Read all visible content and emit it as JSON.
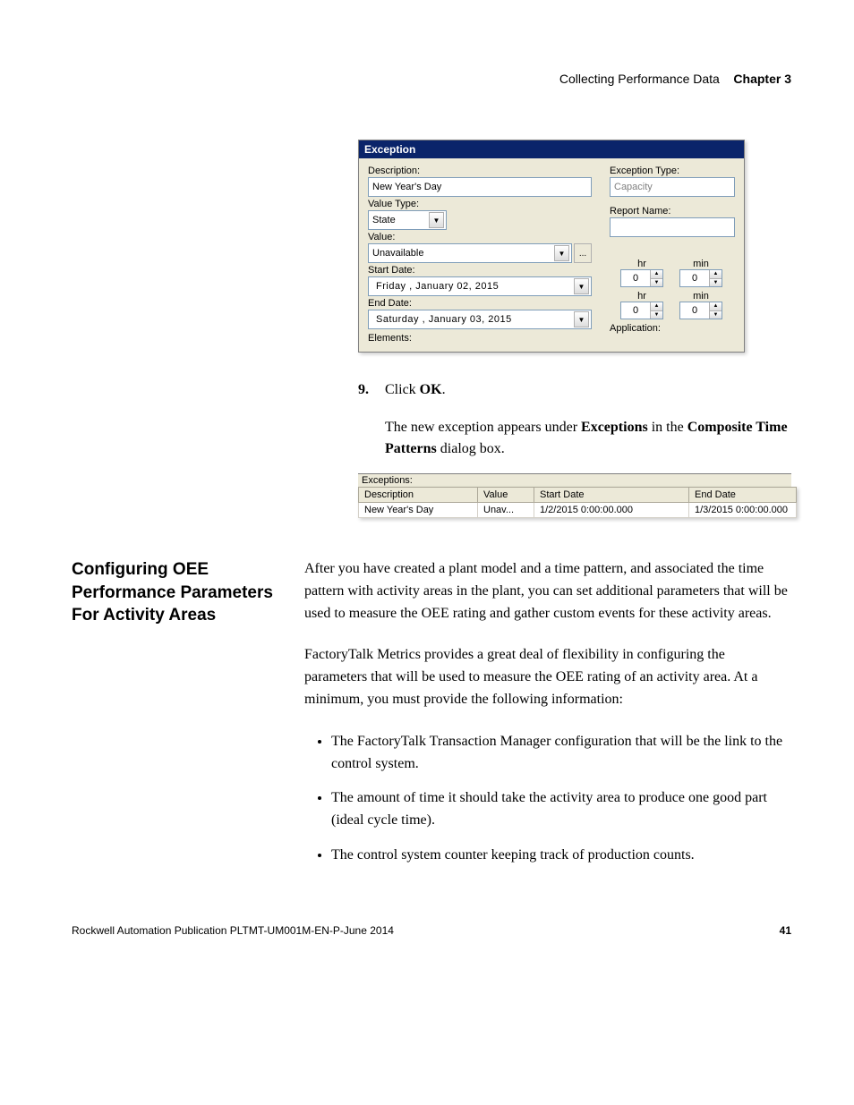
{
  "header": {
    "light": "Collecting Performance Data",
    "bold": "Chapter 3"
  },
  "dialog": {
    "title": "Exception",
    "description_label": "Description:",
    "description_value": "New Year's Day",
    "value_type_label": "Value Type:",
    "value_type_value": "State",
    "value_label": "Value:",
    "value_value": "Unavailable",
    "start_date_label": "Start Date:",
    "start_date_value": "Friday    ,   January   02, 2015",
    "end_date_label": "End Date:",
    "end_date_value": "Saturday ,   January   03, 2015",
    "elements_label": "Elements:",
    "exception_type_label": "Exception Type:",
    "exception_type_value": "Capacity",
    "report_name_label": "Report Name:",
    "report_name_value": "",
    "hr_label": "hr",
    "min_label": "min",
    "start_hr": "0",
    "start_min": "0",
    "end_hr": "0",
    "end_min": "0",
    "application_label": "Application:"
  },
  "step": {
    "num": "9.",
    "text_prefix": "Click ",
    "text_bold": "OK",
    "text_suffix": "."
  },
  "para": {
    "p1a": "The new exception appears under ",
    "p1b": "Exceptions",
    "p1c": " in the ",
    "p1d": "Composite Time Patterns",
    "p1e": " dialog box."
  },
  "exc_table": {
    "label": "Exceptions:",
    "headers": [
      "Description",
      "Value",
      "Start Date",
      "End Date"
    ],
    "row": [
      "New Year's Day",
      "Unav...",
      "1/2/2015 0:00:00.000",
      "1/3/2015 0:00:00.000"
    ]
  },
  "section": {
    "heading": "Configuring OEE Performance Parameters For Activity Areas",
    "p1": "After you have created a plant model and a time pattern, and associated the time pattern with activity areas in the plant, you can set additional parameters that will be used to measure the OEE rating and gather custom events for these activity areas.",
    "p2": "FactoryTalk Metrics provides a great deal of flexibility in configuring the parameters that will be used to measure the OEE rating of an activity area. At a minimum, you must provide the following information:",
    "bullets": [
      "The FactoryTalk Transaction Manager configuration that will be the link to the control system.",
      "The amount of time it should take the activity area to produce one good part (ideal cycle time).",
      "The control system counter keeping track of production counts."
    ]
  },
  "footer": {
    "publication": "Rockwell Automation Publication PLTMT-UM001M-EN-P-June 2014",
    "page": "41"
  }
}
